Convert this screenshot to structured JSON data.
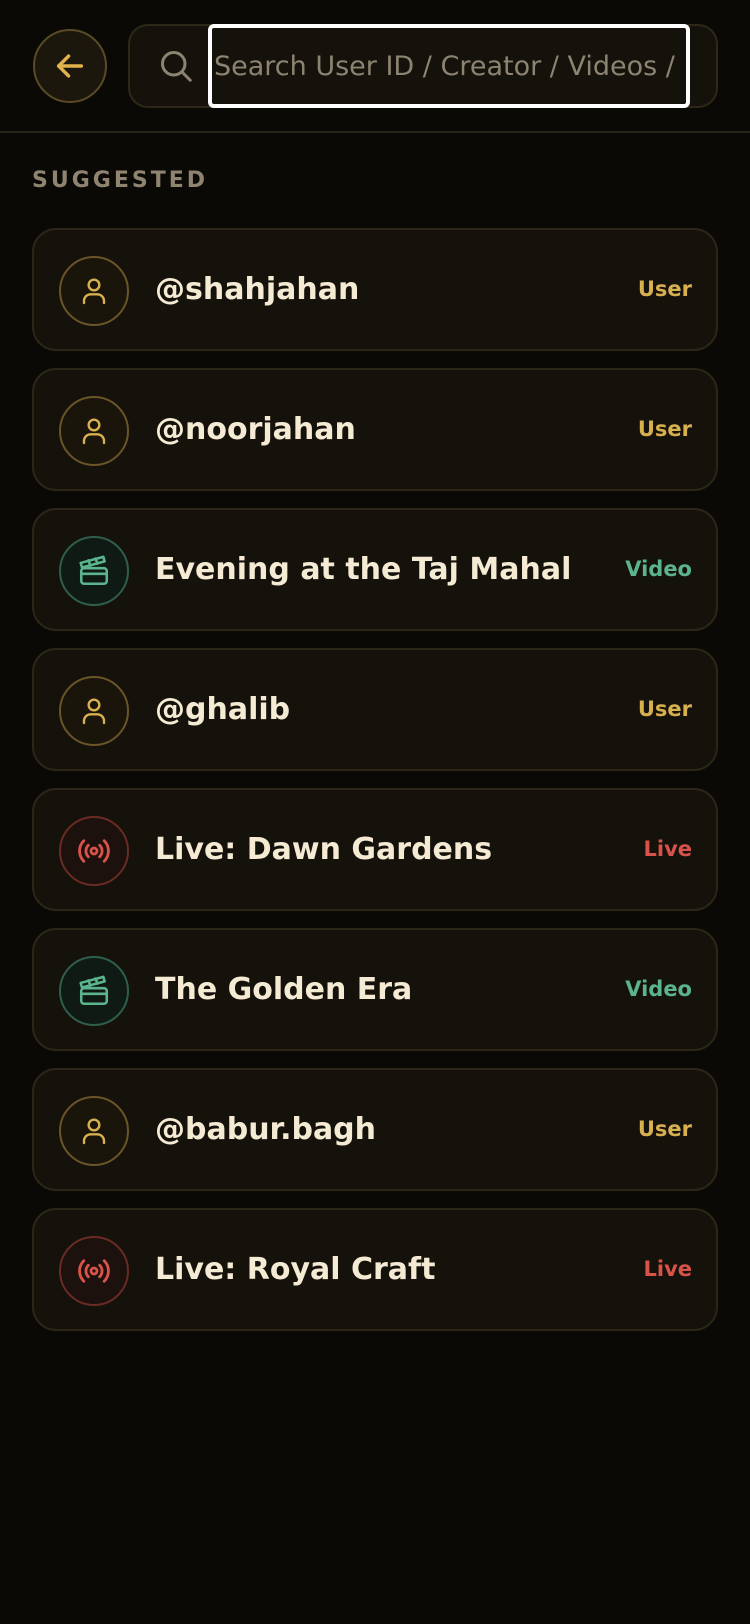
{
  "search": {
    "placeholder": "Search User ID / Creator / Videos / Live"
  },
  "section": {
    "title": "SUGGESTED"
  },
  "suggestions": [
    {
      "label": "@shahjahan",
      "type": "User",
      "icon": "user-icon"
    },
    {
      "label": "@noorjahan",
      "type": "User",
      "icon": "user-icon"
    },
    {
      "label": "Evening at the Taj Mahal",
      "type": "Video",
      "icon": "clapperboard-icon"
    },
    {
      "label": "@ghalib",
      "type": "User",
      "icon": "user-icon"
    },
    {
      "label": "Live: Dawn Gardens",
      "type": "Live",
      "icon": "broadcast-icon"
    },
    {
      "label": "The Golden Era",
      "type": "Video",
      "icon": "clapperboard-icon"
    },
    {
      "label": "@babur.bagh",
      "type": "User",
      "icon": "user-icon"
    },
    {
      "label": "Live: Royal Craft",
      "type": "Live",
      "icon": "broadcast-icon"
    }
  ],
  "colors": {
    "accent": "#d9b04f",
    "video": "#5bb48e",
    "live": "#d9534a",
    "background": "#0a0906"
  }
}
